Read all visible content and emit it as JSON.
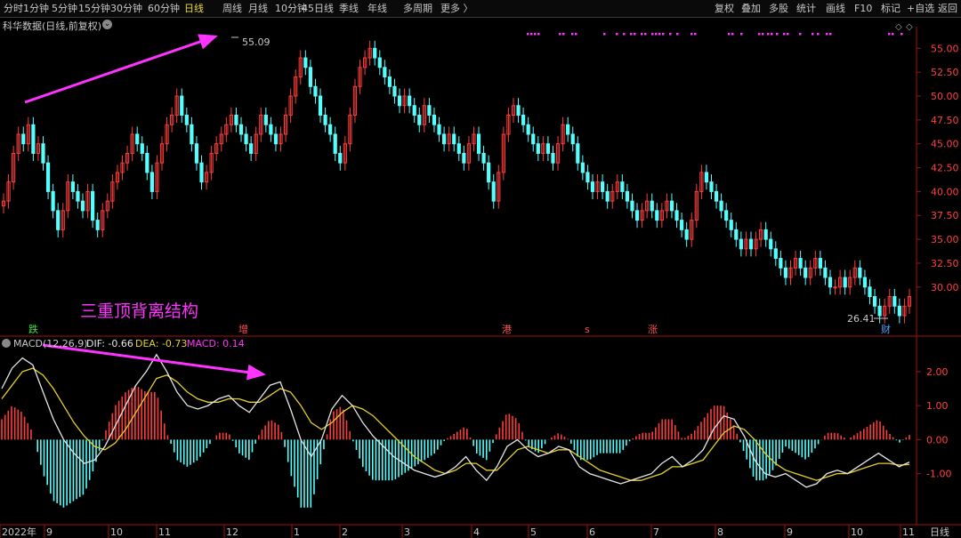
{
  "toolbar": {
    "left": [
      "分时",
      "1分钟",
      "5分钟",
      "15分钟",
      "30分钟",
      "60分钟",
      "日线",
      "周线",
      "月线",
      "10分钟",
      "45日线",
      "季线",
      "年线",
      "多周期",
      "更多 〉"
    ],
    "active": "日线",
    "right": [
      "复权",
      "叠加",
      "多股",
      "统计",
      "画线",
      "F10",
      "标记",
      "+自选",
      "返回"
    ]
  },
  "subtitle": "科华数据(日线,前复权)",
  "subtitle_icon": "chevron-down-icon",
  "colors": {
    "up": "#ff3c3c",
    "down": "#54ffff",
    "dif": "#e6e6e6",
    "dea": "#e6d02a",
    "arrow": "#ff33ff",
    "accent": "#e8d84a",
    "signal": "#ff33ff"
  },
  "chart_data": [
    {
      "type": "candlestick",
      "title": "科华数据(日线,前复权)",
      "ylim": [
        27.0,
        56.8
      ],
      "yticks": [
        30.0,
        32.5,
        35.0,
        37.5,
        40.0,
        42.5,
        45.0,
        47.5,
        50.0,
        52.5,
        55.0
      ],
      "high_label": "55.09",
      "low_label": "26.41",
      "annotation": "三重顶背离结构",
      "event_markers": [
        "跌",
        "增",
        "港",
        "s",
        "涨",
        "财"
      ],
      "closes": [
        39,
        41,
        44,
        46,
        45,
        47,
        44,
        45,
        43,
        40,
        38,
        36,
        38,
        41,
        40,
        39,
        38,
        40,
        37,
        36,
        38,
        39,
        41,
        42,
        43,
        44,
        46,
        45,
        44,
        42,
        40,
        43,
        45,
        47,
        48,
        50,
        48,
        47,
        45,
        43,
        41,
        42,
        44,
        45,
        46,
        47,
        48,
        47,
        46,
        45,
        44,
        46,
        48,
        47,
        46,
        45,
        46,
        48,
        50,
        52,
        54,
        53,
        51,
        50,
        48,
        47,
        46,
        44,
        43,
        45,
        48,
        51,
        53,
        54,
        55,
        54,
        53,
        52,
        51,
        50,
        49,
        50,
        49,
        48,
        47,
        49,
        48,
        47,
        46,
        45,
        46,
        45,
        44,
        43,
        45,
        46,
        44,
        43,
        41,
        39,
        42,
        46,
        48,
        49,
        48,
        47,
        46,
        45,
        44,
        45,
        44,
        43,
        45,
        47,
        46,
        45,
        43,
        42,
        41,
        40,
        41,
        40,
        39,
        40,
        41,
        40,
        39,
        38,
        37,
        38,
        39,
        38,
        37,
        38,
        39,
        38,
        37,
        36,
        35,
        37,
        40,
        42,
        41,
        40,
        39,
        38,
        37,
        36,
        35,
        34,
        35,
        34,
        35,
        36,
        35,
        34,
        33,
        32,
        31,
        32,
        33,
        32,
        31,
        32,
        33,
        32,
        31,
        30,
        30,
        31,
        30,
        31,
        32,
        31,
        30,
        29,
        28,
        27,
        28,
        29,
        28,
        27,
        28,
        29
      ],
      "dates_axis": [
        "2022年",
        "9",
        "10",
        "11",
        "12",
        "1",
        "2",
        "3",
        "4",
        "5",
        "6",
        "7",
        "8",
        "9",
        "10",
        "11"
      ],
      "period_label": "日线"
    },
    {
      "type": "macd",
      "legend": {
        "name": "MACD(12,26,9)",
        "dif": "DIF: -0.66",
        "dea": "DEA: -0.73",
        "macd": "MACD: 0.14"
      },
      "ylim": [
        -2.45,
        2.6
      ],
      "yticks": [
        2.0,
        1.0,
        0.0,
        -1.0
      ],
      "ytick_labels": [
        "2.00",
        "1.00",
        "0.00",
        "-1.00"
      ],
      "dif": [
        1.5,
        2.1,
        2.4,
        2.2,
        1.4,
        0.6,
        0.0,
        -0.4,
        -0.7,
        -0.6,
        -0.2,
        0.4,
        1.0,
        1.6,
        2.0,
        2.5,
        2.0,
        1.4,
        1.0,
        0.9,
        1.0,
        1.2,
        1.3,
        1.0,
        0.8,
        1.2,
        1.6,
        1.7,
        0.9,
        0.0,
        -0.5,
        0.0,
        0.9,
        1.3,
        1.0,
        0.5,
        0.1,
        -0.2,
        -0.5,
        -0.7,
        -0.9,
        -1.0,
        -1.1,
        -1.0,
        -0.8,
        -0.5,
        -0.9,
        -1.2,
        -0.8,
        -0.2,
        0.0,
        -0.3,
        -0.5,
        -0.4,
        -0.2,
        -0.3,
        -0.8,
        -1.0,
        -1.1,
        -1.2,
        -1.3,
        -1.2,
        -1.1,
        -1.0,
        -0.7,
        -0.5,
        -0.8,
        -0.6,
        -0.3,
        0.3,
        0.7,
        0.6,
        0.1,
        -0.6,
        -1.0,
        -1.1,
        -1.0,
        -1.2,
        -1.4,
        -1.3,
        -1.0,
        -0.9,
        -1.0,
        -0.8,
        -0.6,
        -0.4,
        -0.6,
        -0.8,
        -0.66
      ],
      "dea": [
        1.2,
        1.6,
        2.0,
        2.1,
        1.9,
        1.5,
        1.0,
        0.5,
        0.1,
        -0.2,
        -0.3,
        -0.1,
        0.3,
        0.8,
        1.3,
        1.8,
        1.9,
        1.7,
        1.4,
        1.2,
        1.1,
        1.1,
        1.2,
        1.2,
        1.1,
        1.1,
        1.3,
        1.5,
        1.4,
        1.0,
        0.5,
        0.3,
        0.5,
        0.8,
        1.0,
        0.9,
        0.7,
        0.4,
        0.1,
        -0.2,
        -0.5,
        -0.7,
        -0.9,
        -1.0,
        -0.9,
        -0.7,
        -0.7,
        -0.9,
        -0.9,
        -0.6,
        -0.3,
        -0.2,
        -0.3,
        -0.4,
        -0.3,
        -0.3,
        -0.5,
        -0.7,
        -0.9,
        -1.0,
        -1.1,
        -1.2,
        -1.2,
        -1.1,
        -1.0,
        -0.8,
        -0.8,
        -0.7,
        -0.6,
        -0.2,
        0.2,
        0.4,
        0.3,
        0.0,
        -0.4,
        -0.7,
        -0.9,
        -1.0,
        -1.1,
        -1.2,
        -1.1,
        -1.0,
        -1.0,
        -0.9,
        -0.8,
        -0.7,
        -0.7,
        -0.75,
        -0.73
      ],
      "time_labels": [
        "2022年",
        "9",
        "10",
        "11",
        "12",
        "1",
        "2",
        "3",
        "4",
        "5",
        "6",
        "7",
        "8",
        "9",
        "10",
        "11"
      ]
    }
  ]
}
